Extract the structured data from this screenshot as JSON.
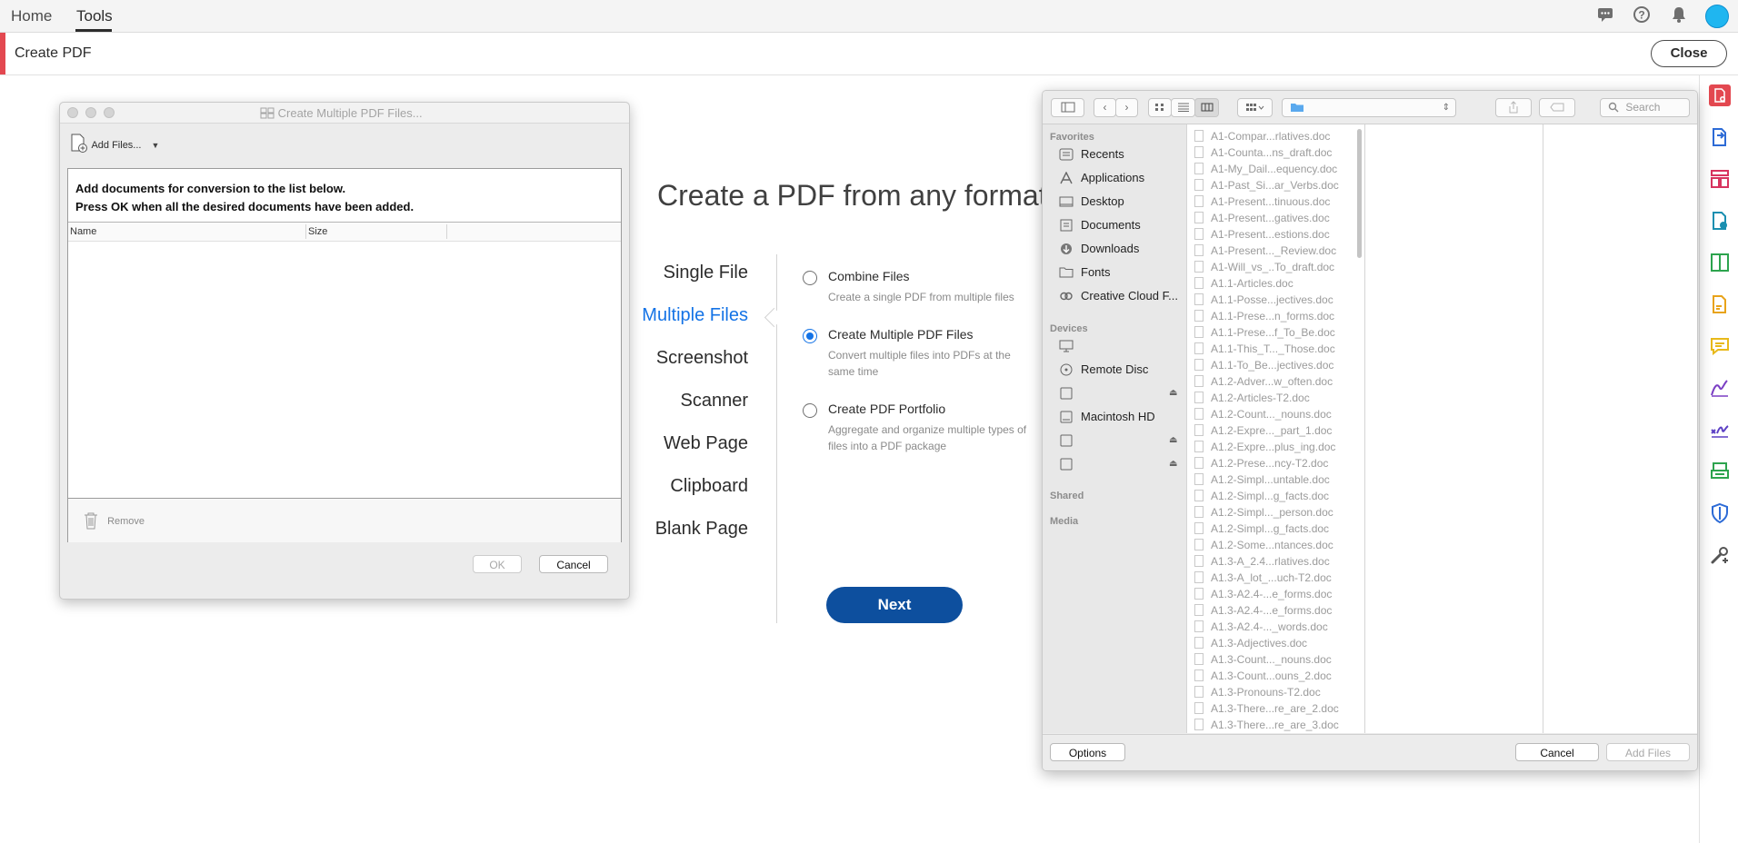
{
  "topnav": {
    "home": "Home",
    "tools": "Tools"
  },
  "toolbar": {
    "title": "Create PDF",
    "close": "Close"
  },
  "main": {
    "heading": "Create a PDF from any format",
    "formats": [
      "Single File",
      "Multiple Files",
      "Screenshot",
      "Scanner",
      "Web Page",
      "Clipboard",
      "Blank Page"
    ],
    "active_format": "Multiple Files",
    "options": [
      {
        "label": "Combine Files",
        "desc": "Create a single PDF from multiple files",
        "selected": false
      },
      {
        "label": "Create Multiple PDF Files",
        "desc": "Convert multiple files into PDFs at the same time",
        "selected": true
      },
      {
        "label": "Create PDF Portfolio",
        "desc": "Aggregate and organize multiple types of files into a PDF package",
        "selected": false
      }
    ],
    "next": "Next"
  },
  "dialog": {
    "title": "Create Multiple PDF Files...",
    "add_files": "Add Files...",
    "msg_line1": "Add documents for conversion to the list below.",
    "msg_line2": "Press OK when all the desired documents have been added.",
    "col_name": "Name",
    "col_size": "Size",
    "remove": "Remove",
    "ok": "OK",
    "cancel": "Cancel"
  },
  "finder": {
    "search_placeholder": "Search",
    "sidebar": {
      "favorites_label": "Favorites",
      "favorites": [
        "Recents",
        "Applications",
        "Desktop",
        "Documents",
        "Downloads",
        "Fonts",
        "Creative Cloud F..."
      ],
      "devices_label": "Devices",
      "devices": [
        "",
        "Remote Disc",
        "",
        "Macintosh HD",
        "",
        ""
      ],
      "shared_label": "Shared",
      "media_label": "Media"
    },
    "files": [
      "A1-Compar...rlatives.doc",
      "A1-Counta...ns_draft.doc",
      "A1-My_Dail...equency.doc",
      "A1-Past_Si...ar_Verbs.doc",
      "A1-Present...tinuous.doc",
      "A1-Present...gatives.doc",
      "A1-Present...estions.doc",
      "A1-Present..._Review.doc",
      "A1-Will_vs_..To_draft.doc",
      "A1.1-Articles.doc",
      "A1.1-Posse...jectives.doc",
      "A1.1-Prese...n_forms.doc",
      "A1.1-Prese...f_To_Be.doc",
      "A1.1-This_T..._Those.doc",
      "A1.1-To_Be...jectives.doc",
      "A1.2-Adver...w_often.doc",
      "A1.2-Articles-T2.doc",
      "A1.2-Count..._nouns.doc",
      "A1.2-Expre..._part_1.doc",
      "A1.2-Expre...plus_ing.doc",
      "A1.2-Prese...ncy-T2.doc",
      "A1.2-Simpl...untable.doc",
      "A1.2-Simpl...g_facts.doc",
      "A1.2-Simpl..._person.doc",
      "A1.2-Simpl...g_facts.doc",
      "A1.2-Some...ntances.doc",
      "A1.3-A_2.4...rlatives.doc",
      "A1.3-A_lot_...uch-T2.doc",
      "A1.3-A2.4-...e_forms.doc",
      "A1.3-A2.4-...e_forms.doc",
      "A1.3-A2.4-..._words.doc",
      "A1.3-Adjectives.doc",
      "A1.3-Count..._nouns.doc",
      "A1.3-Count...ouns_2.doc",
      "A1.3-Pronouns-T2.doc",
      "A1.3-There...re_are_2.doc",
      "A1.3-There...re_are_3.doc"
    ],
    "options": "Options",
    "cancel": "Cancel",
    "add_files": "Add Files"
  },
  "colors": {
    "accent": "#e34850",
    "primary_blue": "#1473e6",
    "next_button": "#0d4f9e"
  }
}
